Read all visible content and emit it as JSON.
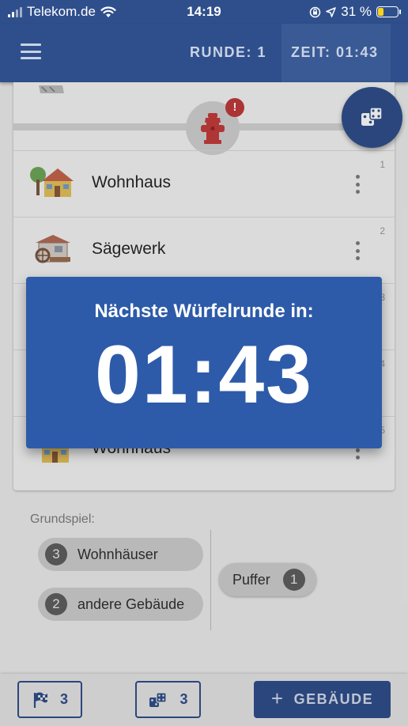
{
  "status_bar": {
    "carrier": "Telekom.de",
    "time": "14:19",
    "battery_percent": "31 %",
    "battery_level": 0.31
  },
  "app_bar": {
    "round_label": "RUNDE: 1",
    "time_label": "ZEIT: 01:43"
  },
  "list": {
    "rows": [
      {
        "label": "Wohnhaus",
        "number": "1"
      },
      {
        "label": "Sägewerk",
        "number": "2"
      },
      {
        "label": "",
        "number": "3"
      },
      {
        "label": "",
        "number": "4"
      },
      {
        "label": "Wohnhaus",
        "number": "5"
      }
    ]
  },
  "popup": {
    "title": "Nächste Würfelrunde in:",
    "countdown": "01:43"
  },
  "grundspiel": {
    "label": "Grundspiel:",
    "chips": [
      {
        "count": "3",
        "text": "Wohnhäuser"
      },
      {
        "count": "2",
        "text": "andere Gebäude"
      }
    ],
    "buffer": {
      "text": "Puffer",
      "count": "1"
    }
  },
  "bottom_bar": {
    "flag_count": "3",
    "dice_count": "3",
    "add_building_label": "GEBÄUDE"
  },
  "colors": {
    "primary": "#2f4f8c",
    "popup": "#2d5ba9",
    "alert": "#c03a3a",
    "hydrant": "#c43b3b"
  }
}
